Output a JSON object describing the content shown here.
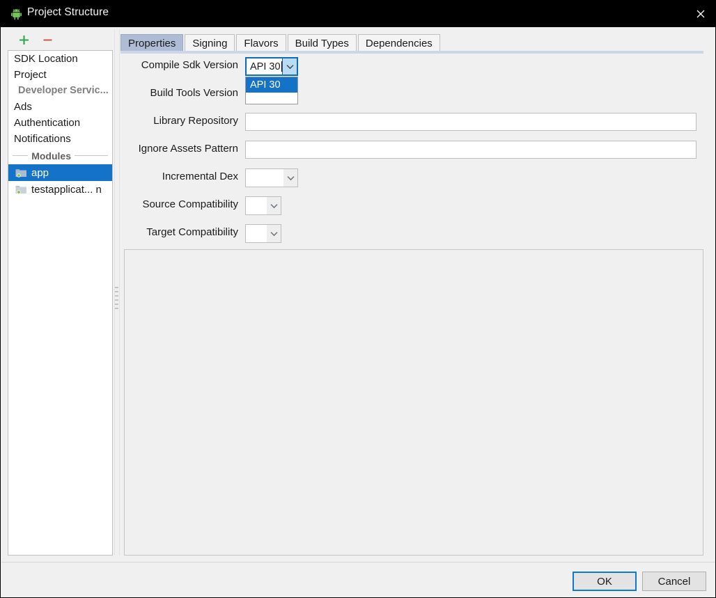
{
  "window": {
    "title": "Project Structure",
    "app_icon": "android-robot-icon",
    "close_label": "✕"
  },
  "sidebar": {
    "toolbar": {
      "add_label": "+",
      "remove_label": "−"
    },
    "items": [
      {
        "label": "SDK Location",
        "type": "item",
        "selected": false
      },
      {
        "label": "Project",
        "type": "item",
        "selected": false
      },
      {
        "label": "Developer Servic...",
        "type": "header",
        "selected": false
      },
      {
        "label": "Ads",
        "type": "item",
        "selected": false
      },
      {
        "label": "Authentication",
        "type": "item",
        "selected": false
      },
      {
        "label": "Notifications",
        "type": "item",
        "selected": false
      }
    ],
    "separator_label": "Modules",
    "modules": [
      {
        "label": "app",
        "selected": true
      },
      {
        "label": "testapplicat... n",
        "selected": false
      }
    ]
  },
  "tabs": [
    {
      "label": "Properties",
      "active": true
    },
    {
      "label": "Signing",
      "active": false
    },
    {
      "label": "Flavors",
      "active": false
    },
    {
      "label": "Build Types",
      "active": false
    },
    {
      "label": "Dependencies",
      "active": false
    }
  ],
  "form": {
    "rows": [
      {
        "label": "Compile Sdk Version",
        "kind": "combo",
        "value": "API 30",
        "width": "combo-w-sdk",
        "focused": true
      },
      {
        "label": "Build Tools Version",
        "kind": "combo",
        "value": "",
        "width": "combo-w-buildtools",
        "focused": false
      },
      {
        "label": "Library Repository",
        "kind": "text",
        "value": "",
        "placeholder": ""
      },
      {
        "label": "Ignore Assets Pattern",
        "kind": "text",
        "value": "",
        "placeholder": ""
      },
      {
        "label": "Incremental Dex",
        "kind": "combo",
        "value": "",
        "width": "combo-w-dex",
        "focused": false
      },
      {
        "label": "Source Compatibility",
        "kind": "combo",
        "value": "",
        "width": "combo-w-compat",
        "focused": false
      },
      {
        "label": "Target Compatibility",
        "kind": "combo",
        "value": "",
        "width": "combo-w-compat",
        "focused": false
      }
    ],
    "dropdown": {
      "open": true,
      "options": [
        {
          "label": "API 30",
          "selected": true
        }
      ]
    }
  },
  "footer": {
    "ok_label": "OK",
    "cancel_label": "Cancel"
  },
  "colors": {
    "titlebar_bg": "#000000",
    "selection_blue": "#1473c8",
    "focus_blue": "#0d78d1",
    "active_tab": "#aebcd6",
    "tab_underline": "#ccd6e8",
    "dialog_bg": "#f0f0f0",
    "add_green": "#2ba84a",
    "remove_red": "#d05a4e"
  }
}
